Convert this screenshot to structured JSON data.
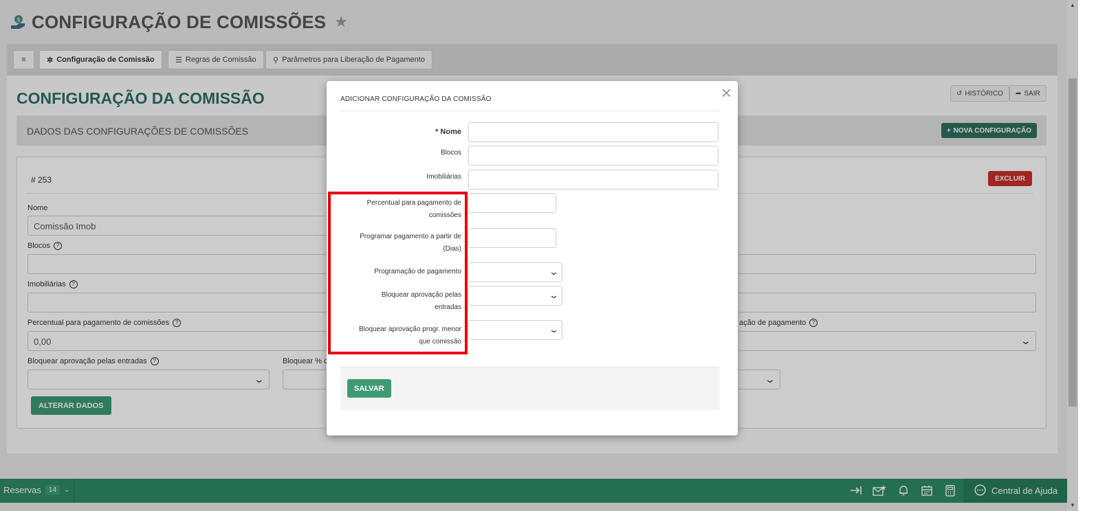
{
  "header": {
    "title": "CONFIGURAÇÃO DE COMISSÕES"
  },
  "tabs": {
    "menu": "≡",
    "items": [
      "Configuração de Comissão",
      "Regras de Comissão",
      "Parâmetros para Liberação de Pagamento"
    ]
  },
  "section": {
    "title": "CONFIGURAÇÃO DA COMISSÃO",
    "historico": "HISTÓRICO",
    "sair": "SAIR",
    "band_title": "DADOS DAS CONFIGURAÇÕES DE COMISSÕES",
    "nova": "NOVA CONFIGURAÇÃO"
  },
  "record": {
    "id": "# 253",
    "excluir": "EXCLUIR",
    "nome_label": "Nome",
    "nome_value": "Comissão Imob",
    "blocos_label": "Blocos",
    "imob_label": "Imobiliárias",
    "percentual_label": "Percentual para pagamento de comissões",
    "percentual_value": "0,00",
    "prog_label_partial": "ação de pagamento",
    "bloquear_entradas_label": "Bloquear aprovação pelas entradas",
    "bloquear_pct_label": "Bloquear % c",
    "alterar": "ALTERAR DADOS"
  },
  "modal": {
    "title": "ADICIONAR CONFIGURAÇÃO DA COMISSÃO",
    "close": "×",
    "nome": "* Nome",
    "blocos": "Blocos",
    "imobiliarias": "Imobiliárias",
    "percentual_1": "Percentual para pagamento de",
    "percentual_2": "comissões",
    "programar_1": "Programar pagamento a partir de",
    "programar_2": "(Dias)",
    "programacao": "Programação de pagamento",
    "bloq_entradas_1": "Bloquear aprovação pelas",
    "bloq_entradas_2": "entradas",
    "bloq_progr_1": "Bloquear aprovação progr. menor",
    "bloq_progr_2": "que comissão",
    "salvar": "SALVAR"
  },
  "bottombar": {
    "reservas": "Reservas",
    "reservas_count": "14",
    "help": "Central de Ajuda"
  },
  "colors": {
    "primary_green": "#2e8a66",
    "title_teal": "#2e6f66",
    "danger": "#c9302c",
    "highlight": "#e8000b"
  }
}
